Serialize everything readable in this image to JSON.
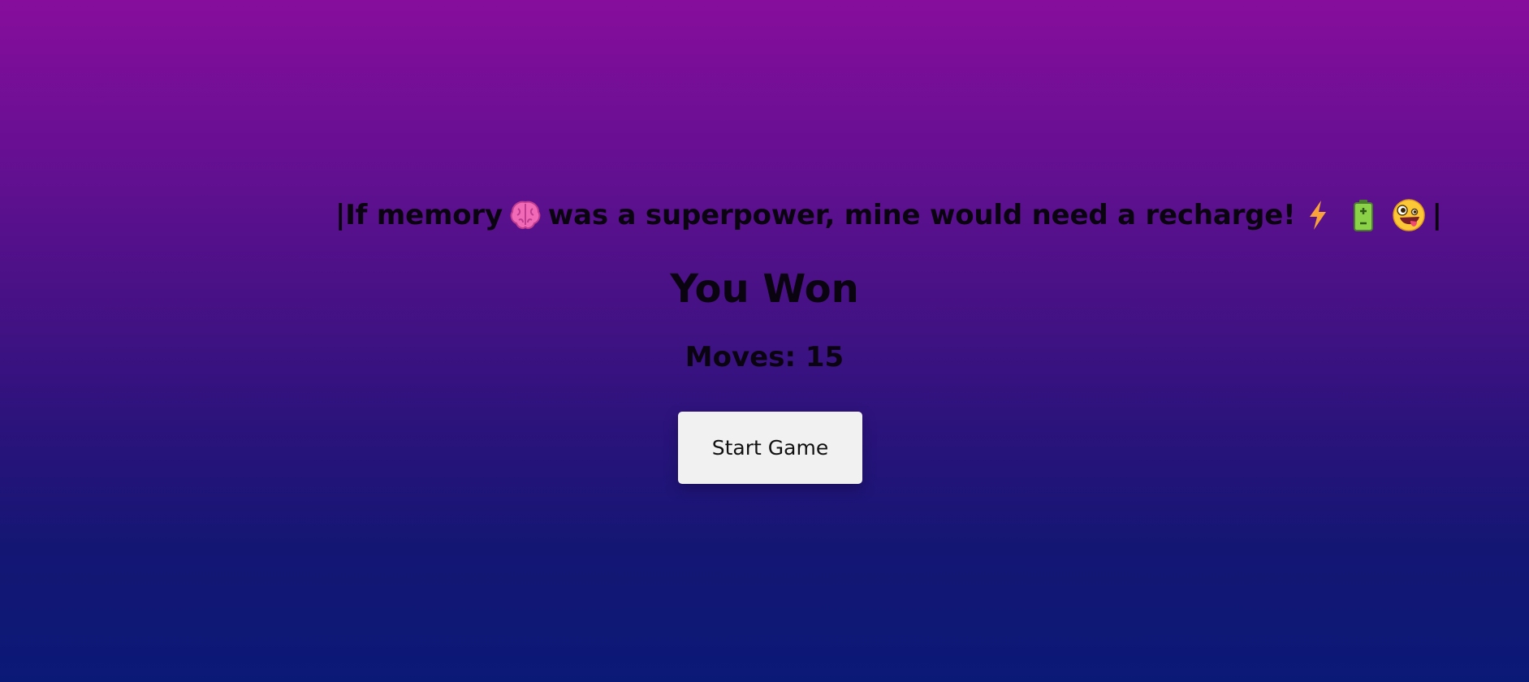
{
  "tagline": {
    "open_bar": "|",
    "part1": "If memory",
    "part2": " was a superpower, mine would need a recharge!",
    "close_bar": "|"
  },
  "result": {
    "title": "You Won",
    "moves_text": "Moves: 15"
  },
  "controls": {
    "start_label": "Start Game"
  },
  "icons": {
    "emoji_1": "brain-icon",
    "emoji_2": "lightning-icon",
    "emoji_3": "battery-icon",
    "emoji_4": "zany-face-icon"
  },
  "colors": {
    "bg_top": "#870e9c",
    "bg_bottom": "#0b1976",
    "text": "#0a0410",
    "button_bg": "#f1f1f1"
  }
}
